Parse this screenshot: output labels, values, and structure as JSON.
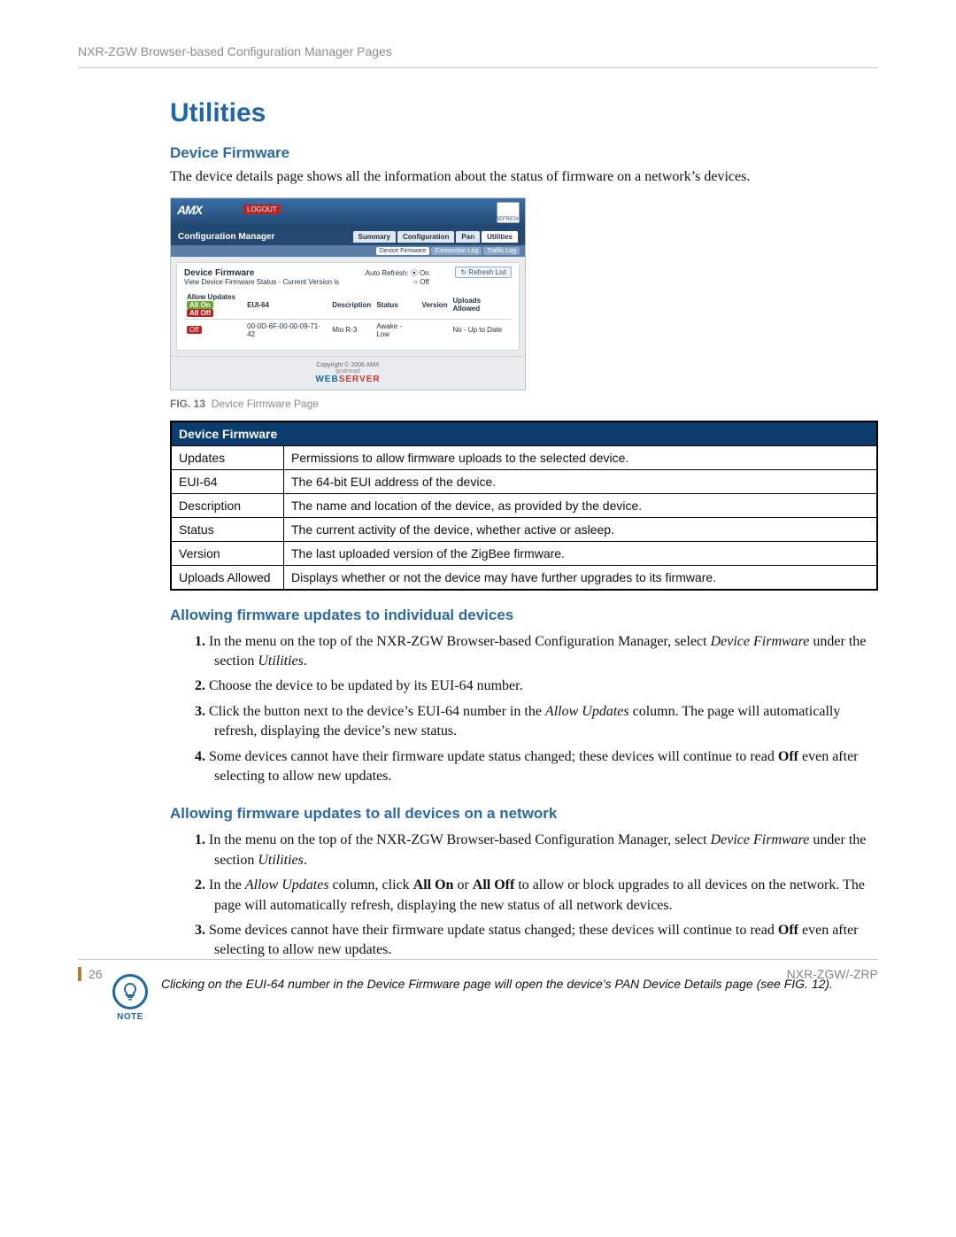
{
  "header": {
    "running_head": "NXR-ZGW Browser-based Configuration Manager Pages"
  },
  "section": {
    "title": "Utilities",
    "sub1": "Device Firmware",
    "intro": "The device details page shows all the information about the status of firmware on a network’s devices."
  },
  "figure13": {
    "caption_num": "FIG. 13",
    "caption_text": "Device Firmware Page",
    "logo_text": "AMX",
    "logout": "LOGOUT",
    "refresh_top": "REFRESH",
    "cfg_mgr": "Configuration Manager",
    "tabs": [
      "Summary",
      "Configuration",
      "Pan",
      "Utilities"
    ],
    "active_tab": "Utilities",
    "subtabs": [
      "Device Firmware",
      "Connection Log",
      "Traffic Log"
    ],
    "active_subtab": "Device Firmware",
    "panel_title": "Device Firmware",
    "panel_desc": "View Device Firmware Status - Current Version is",
    "auto_refresh_label": "Auto Refresh:",
    "auto_refresh_on": "On",
    "auto_refresh_off": "Off",
    "refresh_list": "Refresh List",
    "cols": {
      "allow_updates": "Allow Updates",
      "eui64": "EUI-64",
      "description": "Description",
      "status": "Status",
      "version": "Version",
      "uploads": "Uploads Allowed"
    },
    "allow_all_on": "All On",
    "allow_all_off": "All Off",
    "row": {
      "off": "Off",
      "eui64": "00-0D-6F-00-00-09-71-42",
      "desc": "Mio R-3",
      "status": "Awake - Low",
      "version": "",
      "uploads": "No - Up to Date"
    },
    "copyright": "Copyright © 2006 AMX",
    "goahead": "goahead",
    "webserver_1": "WEB",
    "webserver_2": "SERVER"
  },
  "doc_table": {
    "header": "Device Firmware",
    "rows": [
      {
        "k": "Updates",
        "v": "Permissions to allow firmware uploads to the selected device."
      },
      {
        "k": "EUI-64",
        "v": "The 64-bit EUI address of the device."
      },
      {
        "k": "Description",
        "v": "The name and location of the device, as provided by the device."
      },
      {
        "k": "Status",
        "v": "The current activity of the device, whether active or asleep."
      },
      {
        "k": "Version",
        "v": "The last uploaded version of the ZigBee firmware."
      },
      {
        "k": "Uploads Allowed",
        "v": "Displays whether or not the device may have further upgrades to its firmware."
      }
    ]
  },
  "proc1": {
    "heading": "Allowing firmware updates to individual devices",
    "steps": [
      {
        "pre": "In the menu on the top of the NXR-ZGW Browser-based Configuration Manager, select ",
        "em1": "Device Firmware",
        "mid": " under the section ",
        "em2": "Utilities",
        "post": "."
      },
      {
        "pre": "Choose the device to be updated by its EUI-64 number."
      },
      {
        "pre": "Click the button next to the device’s EUI-64 number in the ",
        "em1": "Allow Updates",
        "mid": " column. The page will automatically refresh, displaying the device’s new status."
      },
      {
        "pre": "Some devices cannot have their firmware update status changed; these devices will continue to read ",
        "b1": "Off",
        "post": " even after selecting to allow new updates."
      }
    ]
  },
  "proc2": {
    "heading": "Allowing firmware updates to all devices on a network",
    "steps": [
      {
        "pre": "In the menu on the top of the NXR-ZGW Browser-based Configuration Manager, select ",
        "em1": "Device Firmware",
        "mid": " under the section ",
        "em2": "Utilities",
        "post": "."
      },
      {
        "pre": "In the ",
        "em1": "Allow Updates",
        "mid": " column, click ",
        "b1": "All On",
        "mid2": " or ",
        "b2": "All Off",
        "post": " to allow or block upgrades to all devices on the network. The page will automatically refresh, displaying the new status of all network devices."
      },
      {
        "pre": "Some devices cannot have their firmware update status changed; these devices will continue to read ",
        "b1": "Off",
        "post": " even after selecting to allow new updates."
      }
    ]
  },
  "note": {
    "label": "NOTE",
    "text": "Clicking on the EUI-64 number in the Device Firmware page will open the device’s PAN Device Details page (see FIG. 12)."
  },
  "footer": {
    "page_number": "26",
    "doc_id": "NXR-ZGW/-ZRP"
  }
}
